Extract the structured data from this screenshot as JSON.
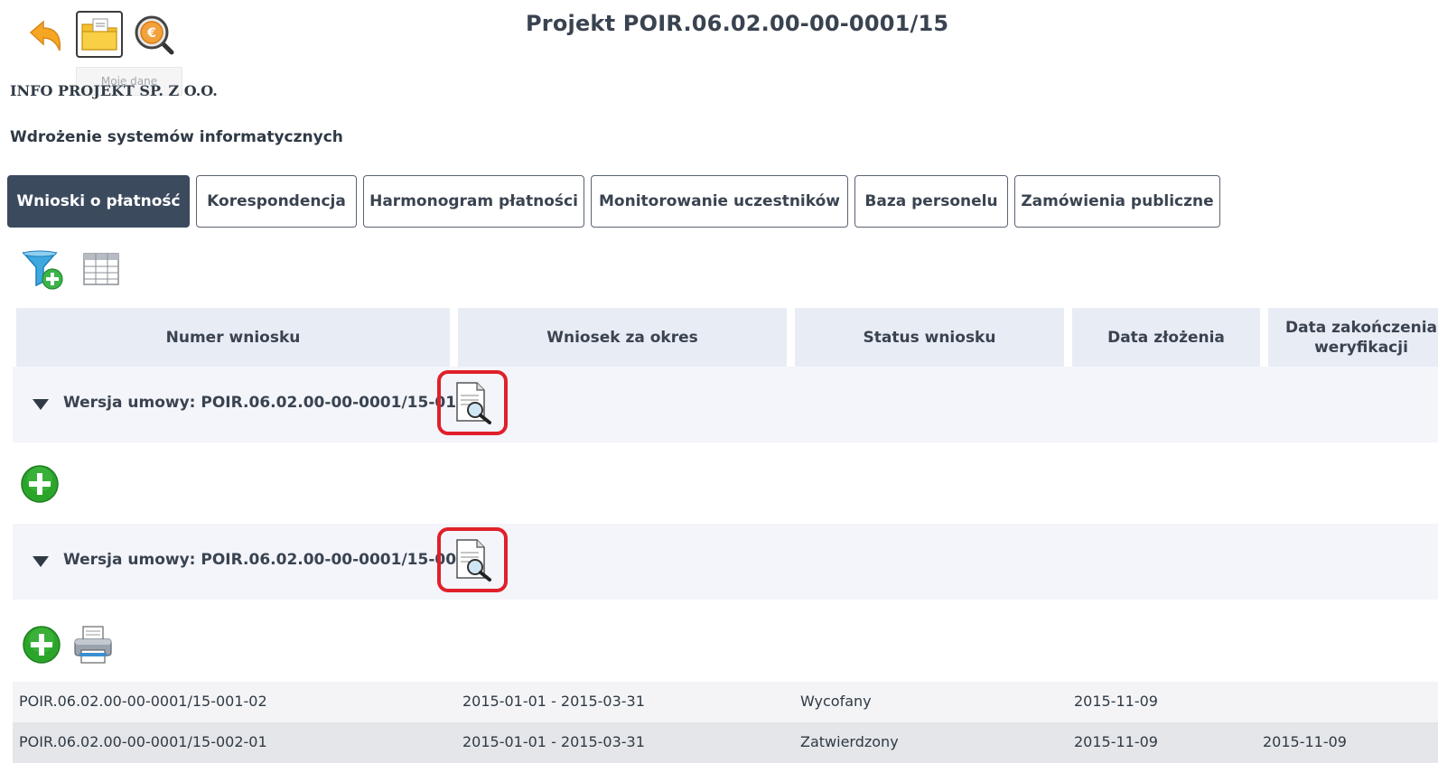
{
  "header": {
    "title": "Projekt POIR.06.02.00-00-0001/15",
    "tooltip": "Moje dane"
  },
  "project": {
    "company": "INFO PROJEKT SP. Z O.O.",
    "name": "Wdrożenie systemów informatycznych"
  },
  "tabs": [
    {
      "label": "Wnioski o płatność",
      "active": true
    },
    {
      "label": "Korespondencja",
      "active": false
    },
    {
      "label": "Harmonogram płatności",
      "active": false
    },
    {
      "label": "Monitorowanie uczestników",
      "active": false
    },
    {
      "label": "Baza personelu",
      "active": false
    },
    {
      "label": "Zamówienia publiczne",
      "active": false
    }
  ],
  "table": {
    "columns": [
      "Numer wniosku",
      "Wniosek za okres",
      "Status wniosku",
      "Data złożenia",
      "Data zakończenia weryfikacji"
    ],
    "groups": [
      {
        "label": "Wersja umowy: POIR.06.02.00-00-0001/15-01"
      },
      {
        "label": "Wersja umowy: POIR.06.02.00-00-0001/15-00"
      }
    ],
    "rows": [
      {
        "numer": "POIR.06.02.00-00-0001/15-001-02",
        "okres": "2015-01-01 - 2015-03-31",
        "status": "Wycofany",
        "data_zlozenia": "2015-11-09",
        "data_zakonczenia": ""
      },
      {
        "numer": "POIR.06.02.00-00-0001/15-002-01",
        "okres": "2015-01-01 - 2015-03-31",
        "status": "Zatwierdzony",
        "data_zlozenia": "2015-11-09",
        "data_zakonczenia": "2015-11-09"
      }
    ]
  },
  "icons": {
    "back": "back-arrow-icon",
    "folder": "folder-icon",
    "search_euro": "euro-search-icon",
    "filter": "filter-add-icon",
    "columns": "table-columns-icon",
    "preview": "document-preview-icon",
    "add": "add-icon",
    "print": "printer-icon"
  },
  "colors": {
    "accent": "#3c4a5e",
    "highlight": "#e0202a",
    "add_green": "#2aa52a"
  }
}
